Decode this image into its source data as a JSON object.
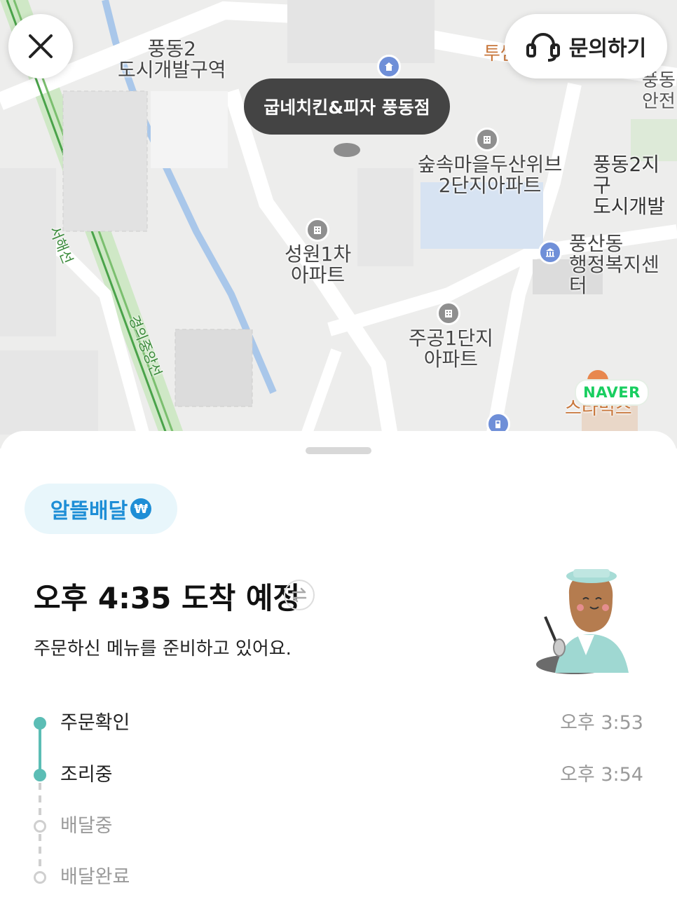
{
  "map": {
    "labels": {
      "area_pungdong2": "풍동2\n도시개발구역",
      "apt_sup": "숲속마을두산위브\n2단지아파트",
      "area_pungdong2_right": "풍동2지구\n도시개발",
      "apt_sungwon": "성원1차\n아파트",
      "office_pungsan": "풍산동\n행정복지센터",
      "apt_jugong": "주공1단지\n아파트",
      "top_right_partial": "풍동\n안전",
      "top_orange_partial": "투썸",
      "starbucks": "스타벅스"
    },
    "line_labels": {
      "seohae": "서해선",
      "gyeongui": "경의중앙선"
    },
    "store_name": "굽네치킨&피자 풍동점",
    "naver_logo": "NAVER"
  },
  "header": {
    "close_icon": "close-icon",
    "inquiry_label": "문의하기",
    "inquiry_icon": "headset-icon"
  },
  "order": {
    "delivery_badge": "알뜰배달",
    "badge_icon": "₩",
    "eta_text": "오후 4:35 도착 예정",
    "subtitle": "주문하신 메뉴를 준비하고 있어요.",
    "steps": [
      {
        "label": "주문확인",
        "time": "오후 3:53",
        "done": true
      },
      {
        "label": "조리중",
        "time": "오후 3:54",
        "done": true
      },
      {
        "label": "배달중",
        "time": "",
        "done": false
      },
      {
        "label": "배달완료",
        "time": "",
        "done": false
      }
    ]
  },
  "colors": {
    "accent_teal": "#5bbdb5",
    "badge_blue": "#1e8ed6",
    "naver_green": "#19ce60"
  }
}
